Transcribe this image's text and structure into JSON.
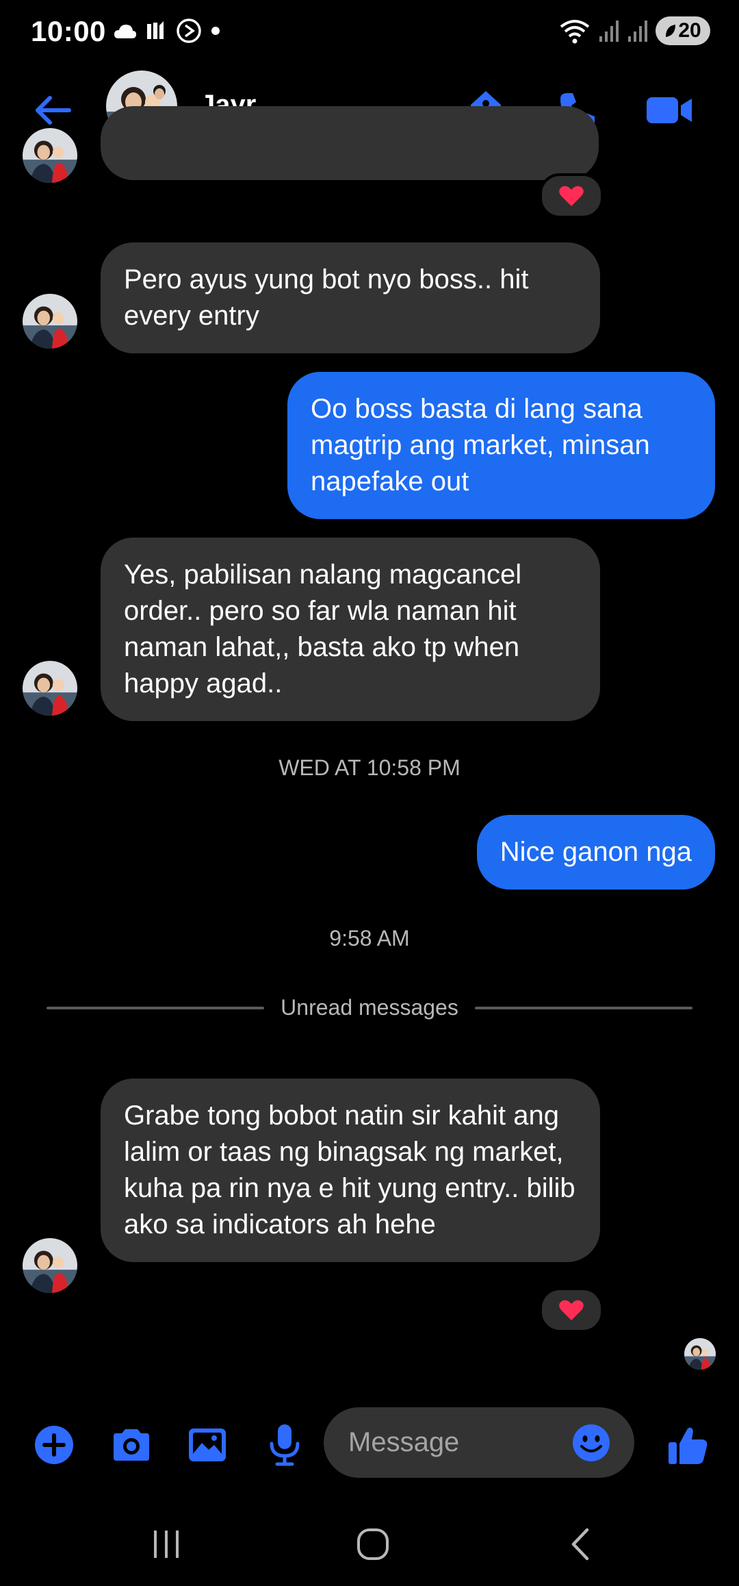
{
  "status_bar": {
    "time": "10:00",
    "battery": "20",
    "left_icons": [
      "cloud-icon",
      "app-m-icon",
      "play-circle-icon",
      "dot-icon"
    ],
    "right_icons": [
      "wifi-icon",
      "signal-icon",
      "signal-icon-2",
      "battery-icon"
    ]
  },
  "header": {
    "contact_name": "Jayr",
    "actions": [
      "tag-icon",
      "phone-icon",
      "video-icon"
    ]
  },
  "messages": [
    {
      "from": "them",
      "text": "Pero ayus yung bot nyo boss.. hit every entry"
    },
    {
      "from": "me",
      "text": "Oo boss basta di lang sana magtrip ang market, minsan napefake out"
    },
    {
      "from": "them",
      "text": "Yes, pabilisan nalang magcancel order.. pero so far wla naman hit naman lahat,, basta ako tp when happy agad.."
    },
    {
      "from": "me",
      "text": "Nice ganon nga"
    },
    {
      "from": "them",
      "text": "Grabe tong bobot natin sir kahit ang lalim or taas ng binagsak ng market, kuha pa rin nya e hit yung entry.. bilib ako sa indicators ah hehe"
    }
  ],
  "timestamps": {
    "first": "WED AT 10:58 PM",
    "second": "9:58 AM"
  },
  "unread_label": "Unread messages",
  "reaction": "heart-reaction",
  "composer": {
    "placeholder": "Message",
    "icons": [
      "plus-icon",
      "camera-icon",
      "gallery-icon",
      "mic-icon",
      "emoji-icon",
      "thumbs-up-icon"
    ]
  },
  "navbar": [
    "recent-apps-icon",
    "home-icon",
    "back-nav-icon"
  ],
  "colors": {
    "accent": "#1d6cf2",
    "icon_blue": "#2f6bff",
    "incoming_bubble": "#333333",
    "background": "#000000"
  }
}
